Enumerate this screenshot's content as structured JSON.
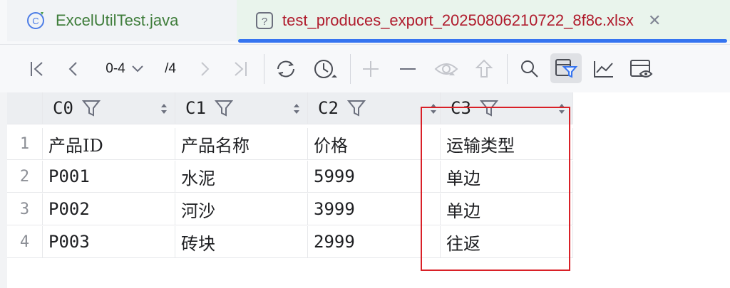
{
  "tabs": [
    {
      "label": "ExcelUtilTest.java",
      "icon": "java-class-icon",
      "active": false
    },
    {
      "label": "test_produces_export_20250806210722_8f8c.xlsx",
      "icon": "unknown-file-icon",
      "active": true
    }
  ],
  "toolbar": {
    "page_range": "0-4",
    "page_total": "/4"
  },
  "columns": [
    "C0",
    "C1",
    "C2",
    "C3"
  ],
  "rows": [
    {
      "num": "1",
      "cells": [
        "产品ID",
        "产品名称",
        "价格",
        "运输类型"
      ]
    },
    {
      "num": "2",
      "cells": [
        "P001",
        "水泥",
        "5999",
        "单边"
      ]
    },
    {
      "num": "3",
      "cells": [
        "P002",
        "河沙",
        "3999",
        "单边"
      ]
    },
    {
      "num": "4",
      "cells": [
        "P003",
        "砖块",
        "2999",
        "往返"
      ]
    }
  ],
  "colors": {
    "accent": "#3574f0",
    "highlight": "#d92027",
    "active_tab_text": "#b01c2d",
    "java_tab_text": "#3f7d3b"
  }
}
